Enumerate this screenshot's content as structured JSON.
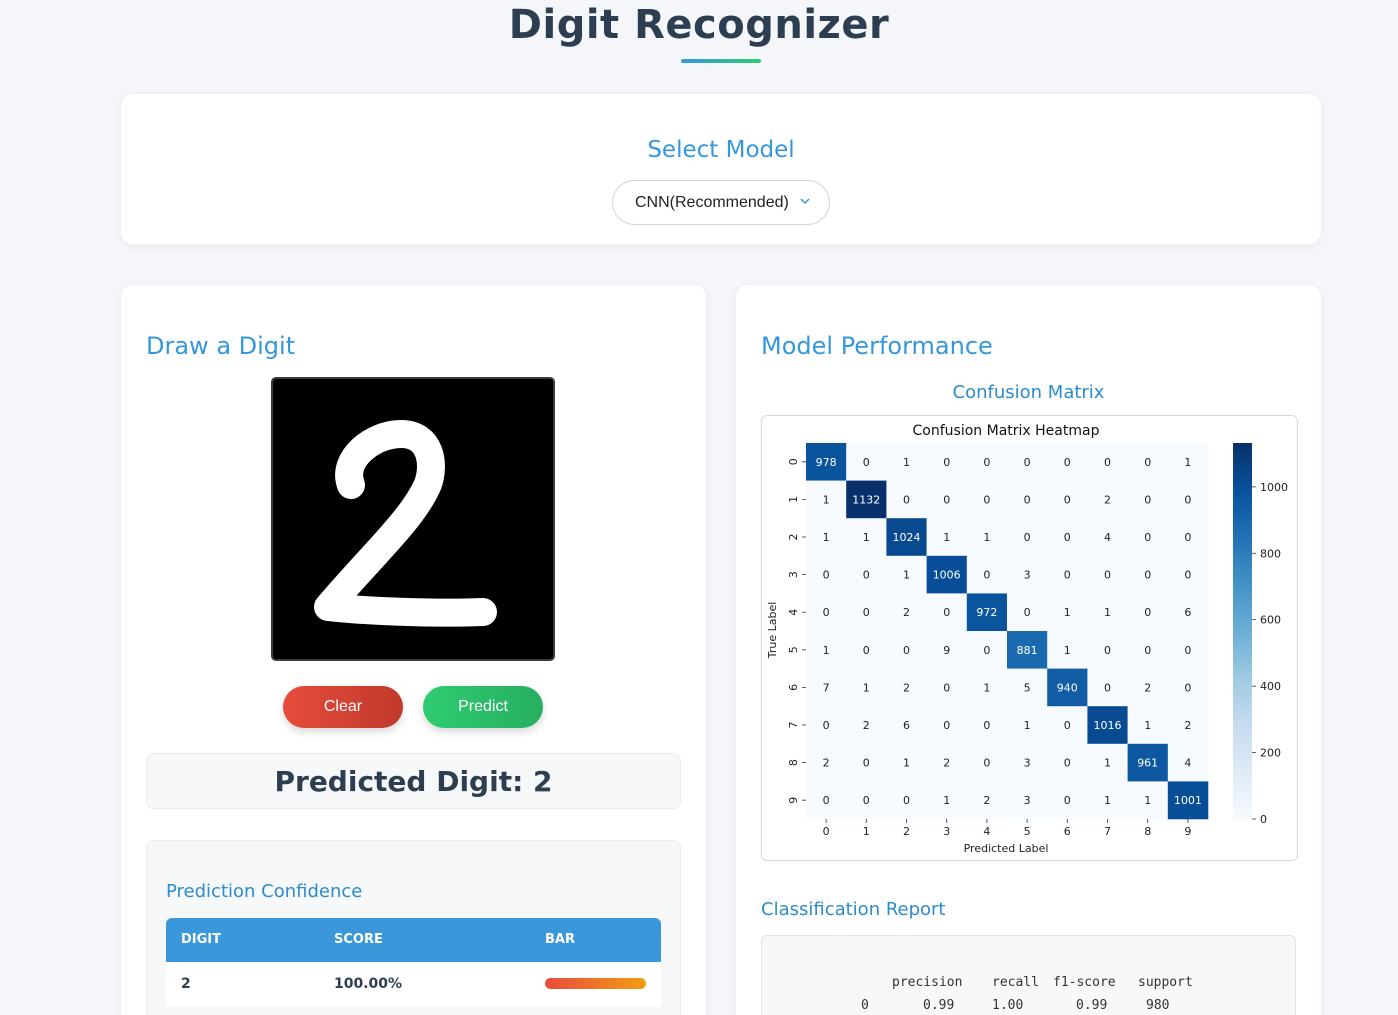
{
  "header": {
    "title": "Digit Recognizer"
  },
  "model_select": {
    "heading": "Select Model",
    "selected": "CNN(Recommended)"
  },
  "draw_panel": {
    "heading": "Draw a Digit",
    "clear_label": "Clear",
    "predict_label": "Predict",
    "predicted_text": "Predicted Digit: 2",
    "confidence": {
      "heading": "Prediction Confidence",
      "columns": [
        "DIGIT",
        "SCORE",
        "BAR"
      ],
      "rows": [
        {
          "digit": "2",
          "score": "100.00%",
          "fraction": 1.0
        }
      ]
    }
  },
  "performance_panel": {
    "heading": "Model Performance",
    "confusion_heading": "Confusion Matrix",
    "report_heading": "Classification Report",
    "report": {
      "columns": [
        "precision",
        "recall",
        "f1-score",
        "support"
      ],
      "rows": [
        {
          "label": "0",
          "precision": "0.99",
          "recall": "1.00",
          "f1": "0.99",
          "support": "980"
        }
      ]
    }
  },
  "chart_data": {
    "type": "heatmap",
    "title": "Confusion Matrix Heatmap",
    "xlabel": "Predicted Label",
    "ylabel": "True Label",
    "x_categories": [
      "0",
      "1",
      "2",
      "3",
      "4",
      "5",
      "6",
      "7",
      "8",
      "9"
    ],
    "y_categories": [
      "0",
      "1",
      "2",
      "3",
      "4",
      "5",
      "6",
      "7",
      "8",
      "9"
    ],
    "values": [
      [
        978,
        0,
        1,
        0,
        0,
        0,
        0,
        0,
        0,
        1
      ],
      [
        1,
        1132,
        0,
        0,
        0,
        0,
        0,
        2,
        0,
        0
      ],
      [
        1,
        1,
        1024,
        1,
        1,
        0,
        0,
        4,
        0,
        0
      ],
      [
        0,
        0,
        1,
        1006,
        0,
        3,
        0,
        0,
        0,
        0
      ],
      [
        0,
        0,
        2,
        0,
        972,
        0,
        1,
        1,
        0,
        6
      ],
      [
        1,
        0,
        0,
        9,
        0,
        881,
        1,
        0,
        0,
        0
      ],
      [
        7,
        1,
        2,
        0,
        1,
        5,
        940,
        0,
        2,
        0
      ],
      [
        0,
        2,
        6,
        0,
        0,
        1,
        0,
        1016,
        1,
        2
      ],
      [
        2,
        0,
        1,
        2,
        0,
        3,
        0,
        1,
        961,
        4
      ],
      [
        0,
        0,
        0,
        1,
        2,
        3,
        0,
        1,
        1,
        1001
      ]
    ],
    "colorbar_ticks": [
      0,
      200,
      400,
      600,
      800,
      1000
    ],
    "color_range": [
      0,
      1132
    ],
    "colormap": "Blues"
  }
}
